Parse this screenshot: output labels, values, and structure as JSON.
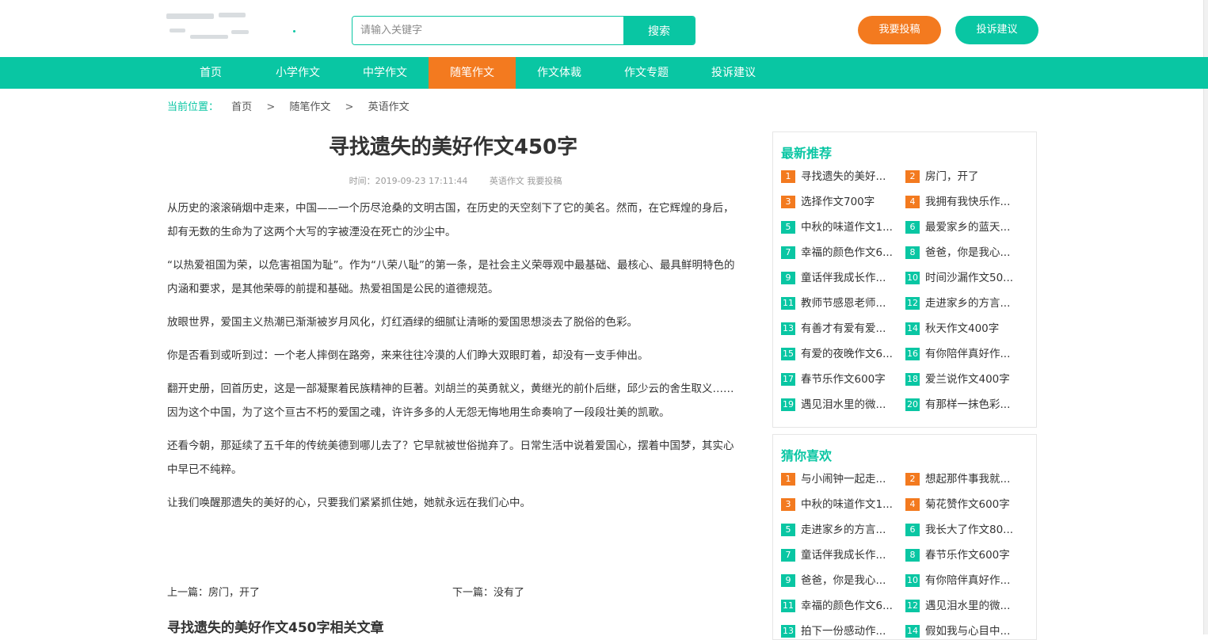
{
  "header": {
    "search_placeholder": "请输入关键字",
    "search_value": "",
    "search_button": "搜索",
    "submit_button": "我要投稿",
    "complaint_button": "投诉建议"
  },
  "nav": [
    {
      "label": "首页",
      "active": false
    },
    {
      "label": "小学作文",
      "active": false
    },
    {
      "label": "中学作文",
      "active": false
    },
    {
      "label": "随笔作文",
      "active": true
    },
    {
      "label": "作文体裁",
      "active": false
    },
    {
      "label": "作文专题",
      "active": false
    },
    {
      "label": "投诉建议",
      "active": false
    }
  ],
  "breadcrumb": {
    "label": "当前位置：",
    "items": [
      "首页",
      "随笔作文",
      "英语作文"
    ],
    "separator": ">"
  },
  "article": {
    "title": "寻找遗失的美好作文450字",
    "time": "时间：2019-09-23 17:11:44",
    "category": "英语作文",
    "submit": "我要投稿",
    "paragraphs": [
      "从历史的滚滚硝烟中走来，中国——一个历尽沧桑的文明古国，在历史的天空刻下了它的美名。然而，在它辉煌的身后，却有无数的生命为了这两个大写的字被湮没在死亡的沙尘中。",
      "“以热爱祖国为荣，以危害祖国为耻”。作为“八荣八耻”的第一条，是社会主义荣辱观中最基础、最核心、最具鲜明特色的内涵和要求，是其他荣辱的前提和基础。热爱祖国是公民的道德规范。",
      "放眼世界，爱国主义热潮已渐渐被岁月风化，灯红酒绿的细腻让清晰的爱国思想淡去了脱俗的色彩。",
      "你是否看到或听到过：一个老人摔倒在路旁，来来往往冷漠的人们睁大双眼盯着，却没有一支手伸出。",
      "翻开史册，回首历史，这是一部凝聚着民族精神的巨著。刘胡兰的英勇就义，黄继光的前仆后继，邱少云的舍生取义……因为这个中国，为了这个亘古不朽的爱国之魂，许许多多的人无怨无悔地用生命奏响了一段段壮美的凯歌。",
      "还看今朝，那延续了五千年的传统美德到哪儿去了？它早就被世俗抛弃了。日常生活中说着爱国心，摆着中国梦，其实心中早已不纯粹。",
      "让我们唤醒那遗失的美好的心，只要我们紧紧抓住她，她就永远在我们心中。"
    ],
    "prev": "上一篇：房门，开了",
    "next": "下一篇：没有了",
    "related_title": "寻找遗失的美好作文450字相关文章"
  },
  "sidebar": {
    "latest": {
      "title": "最新推荐",
      "items": [
        {
          "n": "1",
          "text": "寻找遗失的美好..."
        },
        {
          "n": "2",
          "text": "房门，开了"
        },
        {
          "n": "3",
          "text": "选择作文700字"
        },
        {
          "n": "4",
          "text": "我拥有我快乐作..."
        },
        {
          "n": "5",
          "text": "中秋的味道作文1..."
        },
        {
          "n": "6",
          "text": "最爱家乡的蓝天..."
        },
        {
          "n": "7",
          "text": "幸福的颜色作文6..."
        },
        {
          "n": "8",
          "text": "爸爸，你是我心..."
        },
        {
          "n": "9",
          "text": "童话伴我成长作..."
        },
        {
          "n": "10",
          "text": "时间沙漏作文50..."
        },
        {
          "n": "11",
          "text": "教师节感恩老师..."
        },
        {
          "n": "12",
          "text": "走进家乡的方言..."
        },
        {
          "n": "13",
          "text": "有善才有爱有爱..."
        },
        {
          "n": "14",
          "text": "秋天作文400字"
        },
        {
          "n": "15",
          "text": "有爱的夜晚作文6..."
        },
        {
          "n": "16",
          "text": "有你陪伴真好作..."
        },
        {
          "n": "17",
          "text": "春节乐作文600字"
        },
        {
          "n": "18",
          "text": "爱兰说作文400字"
        },
        {
          "n": "19",
          "text": "遇见泪水里的微..."
        },
        {
          "n": "20",
          "text": "有那样一抹色彩..."
        }
      ]
    },
    "guess": {
      "title": "猜你喜欢",
      "items": [
        {
          "n": "1",
          "text": "与小闹钟一起走..."
        },
        {
          "n": "2",
          "text": "想起那件事我就..."
        },
        {
          "n": "3",
          "text": "中秋的味道作文1..."
        },
        {
          "n": "4",
          "text": "菊花赞作文600字"
        },
        {
          "n": "5",
          "text": "走进家乡的方言..."
        },
        {
          "n": "6",
          "text": "我长大了作文80..."
        },
        {
          "n": "7",
          "text": "童话伴我成长作..."
        },
        {
          "n": "8",
          "text": "春节乐作文600字"
        },
        {
          "n": "9",
          "text": "爸爸，你是我心..."
        },
        {
          "n": "10",
          "text": "有你陪伴真好作..."
        },
        {
          "n": "11",
          "text": "幸福的颜色作文6..."
        },
        {
          "n": "12",
          "text": "遇见泪水里的微..."
        },
        {
          "n": "13",
          "text": "拍下一份感动作..."
        },
        {
          "n": "14",
          "text": "假如我与心目中..."
        }
      ]
    }
  },
  "colors": {
    "accent": "#09c6a3",
    "highlight": "#f37a1f"
  }
}
